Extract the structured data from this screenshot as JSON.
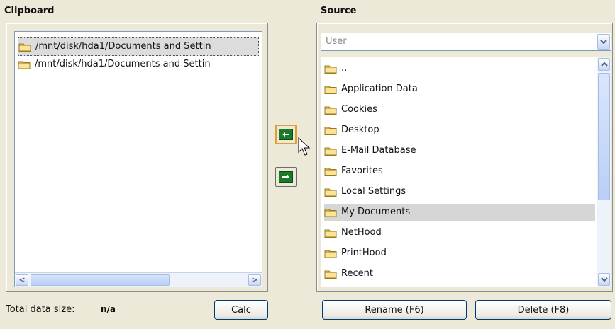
{
  "clipboard": {
    "title": "Clipboard",
    "items": [
      "/mnt/disk/hda1/Documents and Settin",
      "/mnt/disk/hda1/Documents and Settin"
    ]
  },
  "source": {
    "title": "Source",
    "combo_value": "User",
    "items": [
      "..",
      "Application Data",
      "Cookies",
      "Desktop",
      "E-Mail Database",
      "Favorites",
      "Local Settings",
      "My Documents",
      "NetHood",
      "PrintHood",
      "Recent"
    ],
    "selected_index": 7
  },
  "footer": {
    "total_label": "Total data size:",
    "total_value": "n/a",
    "calc_label": "Calc",
    "rename_label": "Rename (F6)",
    "delete_label": "Delete (F8)"
  },
  "colors": {
    "background": "#ece9d8",
    "arrow_green": "#1b7a2a",
    "focus_orange": "#e0a030",
    "selection": "#d6d6d6"
  }
}
